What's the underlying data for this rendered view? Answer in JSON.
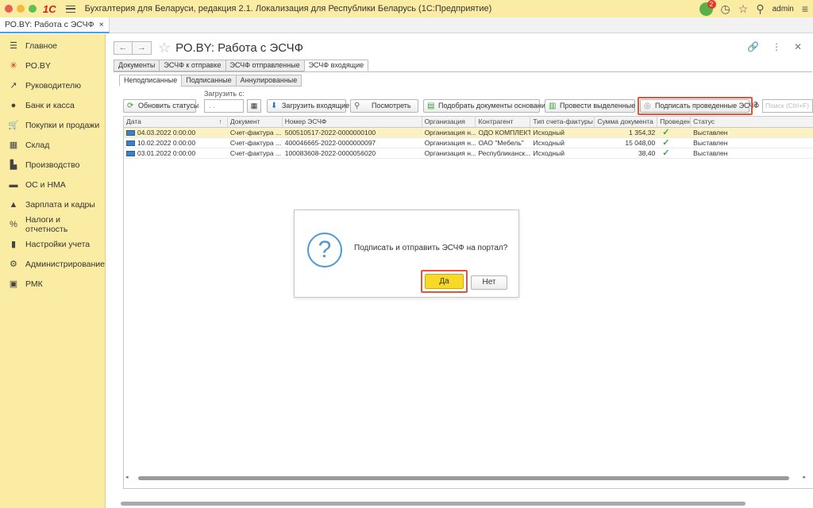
{
  "titlebar": {
    "logo": "1С",
    "title": "Бухгалтерия для Беларуси, редакция 2.1. Локализация для Республики Беларусь   (1С:Предприятие)",
    "notifications_count": "2",
    "user": "admin"
  },
  "open_tab": {
    "label": "РО.BY: Работа с ЭСЧФ",
    "close": "×"
  },
  "sidebar": {
    "items": [
      {
        "label": "Главное",
        "icon": "☰"
      },
      {
        "label": "РО.BY",
        "icon": "✳"
      },
      {
        "label": "Руководителю",
        "icon": "↗"
      },
      {
        "label": "Банк и касса",
        "icon": "●"
      },
      {
        "label": "Покупки и продажи",
        "icon": "🛒"
      },
      {
        "label": "Склад",
        "icon": "▦"
      },
      {
        "label": "Производство",
        "icon": "▙"
      },
      {
        "label": "ОС и НМА",
        "icon": "▬"
      },
      {
        "label": "Зарплата и кадры",
        "icon": "▲"
      },
      {
        "label": "Налоги и отчетность",
        "icon": "%"
      },
      {
        "label": "Настройки учета",
        "icon": "▮"
      },
      {
        "label": "Администрирование",
        "icon": "⚙"
      },
      {
        "label": "РМК",
        "icon": "▣"
      }
    ]
  },
  "form": {
    "title": "РО.BY: Работа с ЭСЧФ",
    "back": "←",
    "forward": "→",
    "tabs": [
      "Документы",
      "ЭСЧФ к отправке",
      "ЭСЧФ отправленные",
      "ЭСЧФ входящие"
    ],
    "subtabs": [
      "Неподписанные",
      "Подписанные",
      "Аннулированные"
    ],
    "load_from_label": "Загрузить с:",
    "date_value": " .  .",
    "toolbar": {
      "refresh": "Обновить статусы",
      "load_incoming": "Загрузить входящие",
      "view": "Посмотреть",
      "pick_docs": "Подобрать документы основания",
      "post_selected": "Провести выделенные",
      "sign_posted": "Подписать проведенные ЭСЧФ",
      "help": "?",
      "search_placeholder": "Поиск (Ctrl+F)"
    }
  },
  "table": {
    "columns": [
      "Дата",
      "Документ",
      "Номер ЭСЧФ",
      "Организация",
      "Контрагент",
      "Тип счета-фактуры",
      "Сумма документа",
      "Проведен",
      "Статус"
    ],
    "sort_mark": "↑",
    "rows": [
      {
        "date": "04.03.2022 0:00:00",
        "doc": "Счет-фактура ...",
        "number": "500510517-2022-0000000100",
        "org": "Организация н...",
        "contractor": "ОДО КОМПЛЕКТ",
        "type": "Исходный",
        "sum": "1 354,32",
        "posted": "✓",
        "status": "Выставлен"
      },
      {
        "date": "10.02.2022 0:00:00",
        "doc": "Счет-фактура ...",
        "number": "400046665-2022-0000000097",
        "org": "Организация н...",
        "contractor": "ОАО \"Мебель\"",
        "type": "Исходный",
        "sum": "15 048,00",
        "posted": "✓",
        "status": "Выставлен"
      },
      {
        "date": "03.01.2022 0:00:00",
        "doc": "Счет-фактура ...",
        "number": "100083608-2022-0000056020",
        "org": "Организация н...",
        "contractor": "Республиканск...",
        "type": "Исходный",
        "sum": "38,40",
        "posted": "✓",
        "status": "Выставлен"
      }
    ]
  },
  "dialog": {
    "icon": "?",
    "message": "Подписать и отправить ЭСЧФ на портал?",
    "yes": "Да",
    "no": "Нет"
  },
  "colors": {
    "sidebar_bg": "#fbeca4",
    "highlight_outline": "#e0553c",
    "primary_button": "#f7d926",
    "selected_row": "#fbf1c2"
  }
}
